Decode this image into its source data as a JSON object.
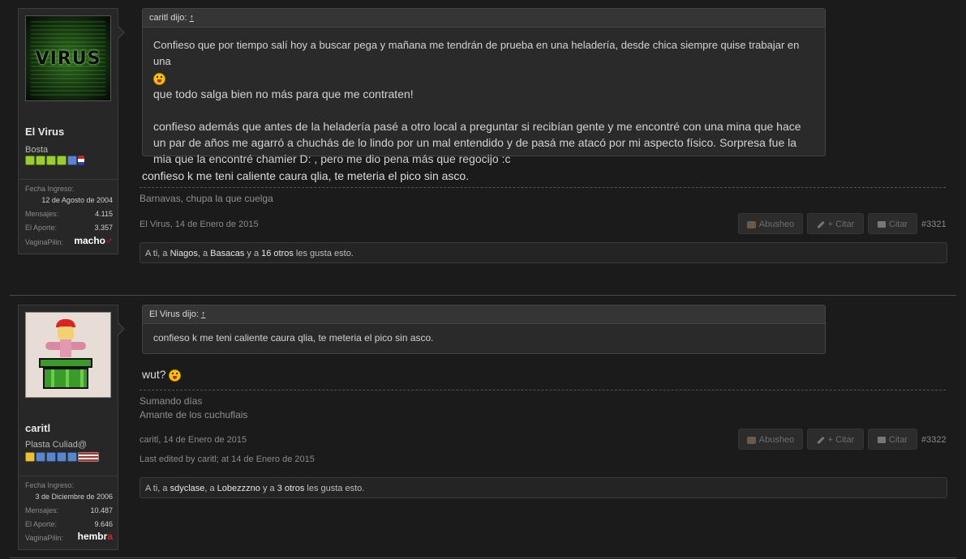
{
  "posts": [
    {
      "username": "El Virus",
      "user_title": "Bosta",
      "avatar_text": "VIRUS",
      "stats": [
        {
          "label": "Fecha Ingreso:",
          "value": "12 de Agosto de 2004"
        },
        {
          "label": "Mensajes:",
          "value": "4.115"
        },
        {
          "label": "El Aporte:",
          "value": "3.357"
        },
        {
          "label": "VaginaPilin:",
          "value": "macho"
        }
      ],
      "gender_symbol": "♂",
      "quote_author": "caritl dijo:",
      "quote_up": "↑",
      "quote_lines": [
        "Confieso que por tiempo salí hoy a buscar pega y mañana me tendrán de prueba en una heladería, desde chica siempre quise trabajar en una",
        "que todo salga bien no más para que me contraten!",
        "confieso además que antes de la heladería pasé a otro local a preguntar si recibían gente y me encontré con una mina que hace",
        "un par de años me agarró a chuchás de lo lindo por un mal entendido y de pasá me atacó por mi aspecto físico. Sorpresa fue la",
        "mia que la encontré chamier D: , pero me dio pena más que regocijo :c"
      ],
      "message": "confieso k me teni caliente caura qlia, te meteria el pico sin asco.",
      "signature": [
        "Barnavas, chupa la que cuelga"
      ],
      "meta": "El Virus, 14 de Enero de 2015",
      "post_number": "#3321",
      "likes": {
        "prefix": "A ti, a ",
        "u1": "Niagos",
        "sep1": ", a ",
        "u2": "Basacas",
        "sep2": " y a ",
        "u3": "16 otros",
        "suffix": " les gusta esto."
      }
    },
    {
      "username": "caritl",
      "user_title": "Plasta Culiad@",
      "stats": [
        {
          "label": "Fecha Ingreso:",
          "value": "3 de Diciembre de 2006"
        },
        {
          "label": "Mensajes:",
          "value": "10.487"
        },
        {
          "label": "El Aporte:",
          "value": "9.646"
        },
        {
          "label": "VaginaPilin:",
          "value": "hembr"
        }
      ],
      "gender_symbol": "a",
      "quote_author": "El Virus dijo:",
      "quote_up": "↑",
      "quote_lines": [
        "confieso k me teni caliente caura qlia, te meteria el pico sin asco."
      ],
      "message": "wut?",
      "signature": [
        "Sumando días",
        "Amante de los cuchuflais"
      ],
      "meta": "caritl, 14 de Enero de 2015",
      "edited": "Last edited by caritl; at 14 de Enero de 2015",
      "post_number": "#3322",
      "likes": {
        "prefix": "A ti, a ",
        "u1": "sdyclase",
        "sep1": ", a ",
        "u2": "Lobezzzno",
        "sep2": " y a ",
        "u3": "3 otros",
        "suffix": " les gusta esto."
      }
    }
  ],
  "buttons": {
    "report": "Abusheo",
    "multiquote": "+ Citar",
    "quote": "Citar"
  }
}
